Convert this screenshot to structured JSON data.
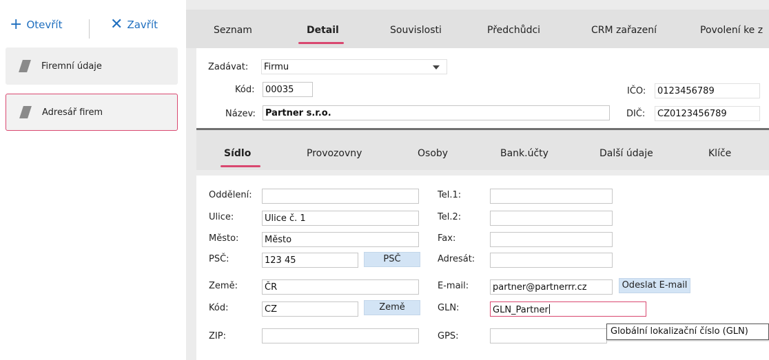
{
  "toolbar": {
    "open_label": "Otevřít",
    "close_label": "Zavřít"
  },
  "sidebar": {
    "items": [
      {
        "label": "Firemní údaje"
      },
      {
        "label": "Adresář firem"
      }
    ]
  },
  "main_tabs": [
    {
      "label": "Seznam"
    },
    {
      "label": "Detail"
    },
    {
      "label": "Souvislosti"
    },
    {
      "label": "Předchůdci"
    },
    {
      "label": "CRM zařazení"
    },
    {
      "label": "Povolení ke z"
    }
  ],
  "header": {
    "zadavat_label": "Zadávat:",
    "zadavat_value": "Firmu",
    "kod_label": "Kód:",
    "kod_value": "00035",
    "nazev_label": "Název:",
    "nazev_value": "Partner s.r.o.",
    "ico_label": "IČO:",
    "ico_value": "0123456789",
    "dic_label": "DIČ:",
    "dic_value": "CZ0123456789"
  },
  "sub_tabs": [
    {
      "label": "Sídlo"
    },
    {
      "label": "Provozovny"
    },
    {
      "label": "Osoby"
    },
    {
      "label": "Bank.účty"
    },
    {
      "label": "Další údaje"
    },
    {
      "label": "Klíče"
    }
  ],
  "address": {
    "oddeleni_label": "Oddělení:",
    "oddeleni_value": "",
    "ulice_label": "Ulice:",
    "ulice_value": "Ulice č. 1",
    "mesto_label": "Město:",
    "mesto_value": "Město",
    "psc_label": "PSČ:",
    "psc_value": "123 45",
    "psc_button": "PSČ",
    "zeme_label": "Země:",
    "zeme_value": "ČR",
    "kod_label": "Kód:",
    "kod_value": "CZ",
    "zeme_button": "Země",
    "zip_label": "ZIP:",
    "zip_value": ""
  },
  "contact": {
    "tel1_label": "Tel.1:",
    "tel1_value": "",
    "tel2_label": "Tel.2:",
    "tel2_value": "",
    "fax_label": "Fax:",
    "fax_value": "",
    "adresat_label": "Adresát:",
    "adresat_value": "",
    "email_label": "E-mail:",
    "email_value": "partner@partnerrr.cz",
    "email_button": "Odeslat E-mail",
    "gln_label": "GLN:",
    "gln_value": "GLN_Partner",
    "gps_label": "GPS:",
    "gps_value": ""
  },
  "tooltip": {
    "text": "Globální lokalizační číslo (GLN)"
  },
  "colors": {
    "accent": "#d9476f",
    "link": "#1f6fbf",
    "button_bg": "#d3e4f5"
  }
}
